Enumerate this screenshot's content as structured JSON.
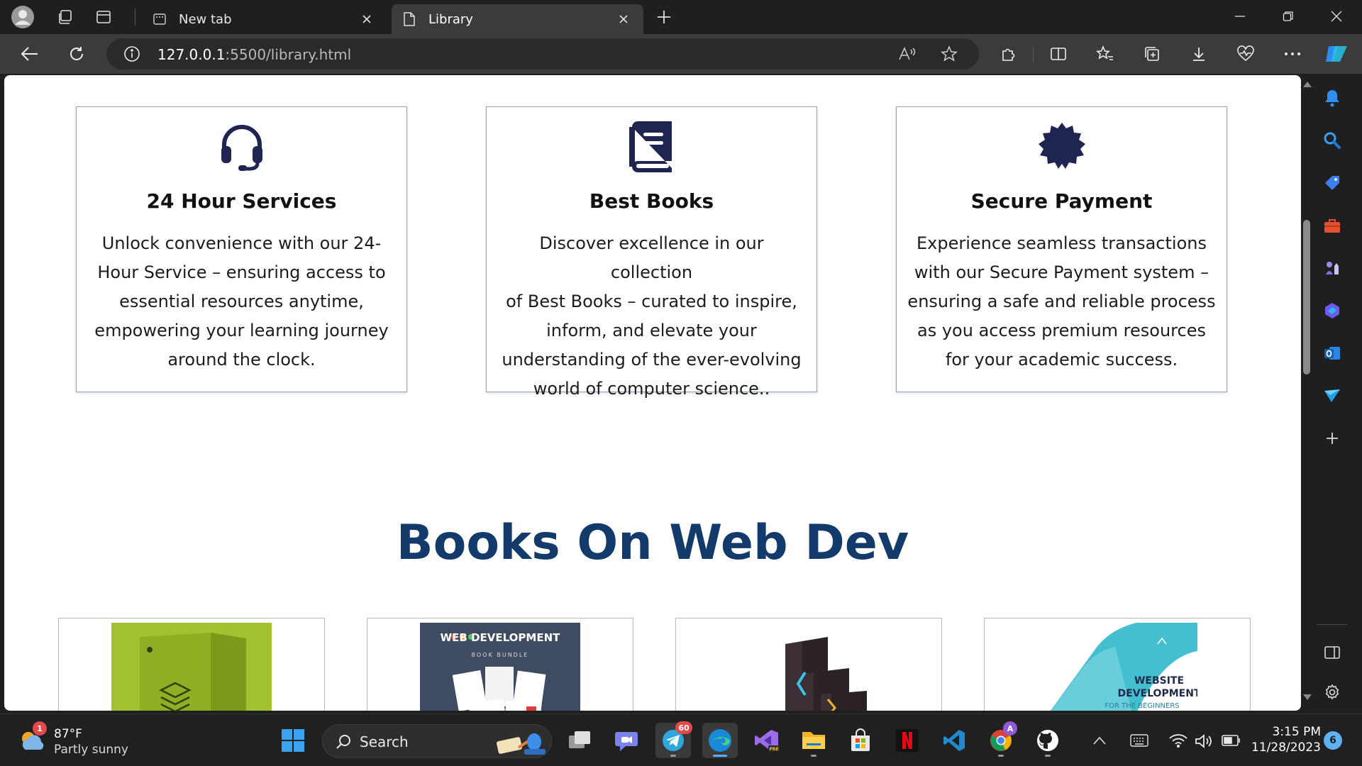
{
  "browser": {
    "tabs": [
      {
        "title": "New tab",
        "active": false
      },
      {
        "title": "Library",
        "active": true
      }
    ],
    "url_host": "127.0.0.1",
    "url_path": ":5500/library.html"
  },
  "page": {
    "features": [
      {
        "icon": "headset-icon",
        "title": "24 Hour Services",
        "description_lines": [
          "Unlock convenience with our 24-",
          "Hour Service – ensuring access to",
          "essential resources anytime,",
          "empowering your learning journey",
          "around the clock."
        ]
      },
      {
        "icon": "book-icon",
        "title": "Best Books",
        "description_lines": [
          "Discover excellence in our collection",
          "of Best Books – curated to inspire,",
          "inform, and elevate your",
          "understanding of the ever-evolving",
          "world of computer science.."
        ]
      },
      {
        "icon": "certificate-badge-icon",
        "title": "Secure Payment",
        "description_lines": [
          "Experience seamless transactions",
          "with our Secure Payment system –",
          "ensuring a safe and reliable process",
          "as you access premium resources",
          "for your academic success."
        ]
      }
    ],
    "section_title": "Books On Web Dev",
    "books": [
      {
        "cover_text": ""
      },
      {
        "cover_text": "WEB DEVELOPMENT",
        "cover_subtext": "BOOK BUNDLE"
      },
      {
        "cover_text": ""
      },
      {
        "cover_text": "WEBSITE DEVELOPMENT",
        "cover_subtext": "FOR THE BEGINNERS"
      }
    ],
    "colors": {
      "heading": "#123a6b",
      "icon": "#1f2450",
      "card_border": "#9aa3bd"
    }
  },
  "taskbar": {
    "weather": {
      "temp": "87°F",
      "condition": "Partly sunny",
      "alert_count": "1"
    },
    "search_label": "Search",
    "telegram_badge": "60",
    "chrome_badge": "A",
    "time": "3:15 PM",
    "date": "11/28/2023",
    "notification_count": "6"
  }
}
